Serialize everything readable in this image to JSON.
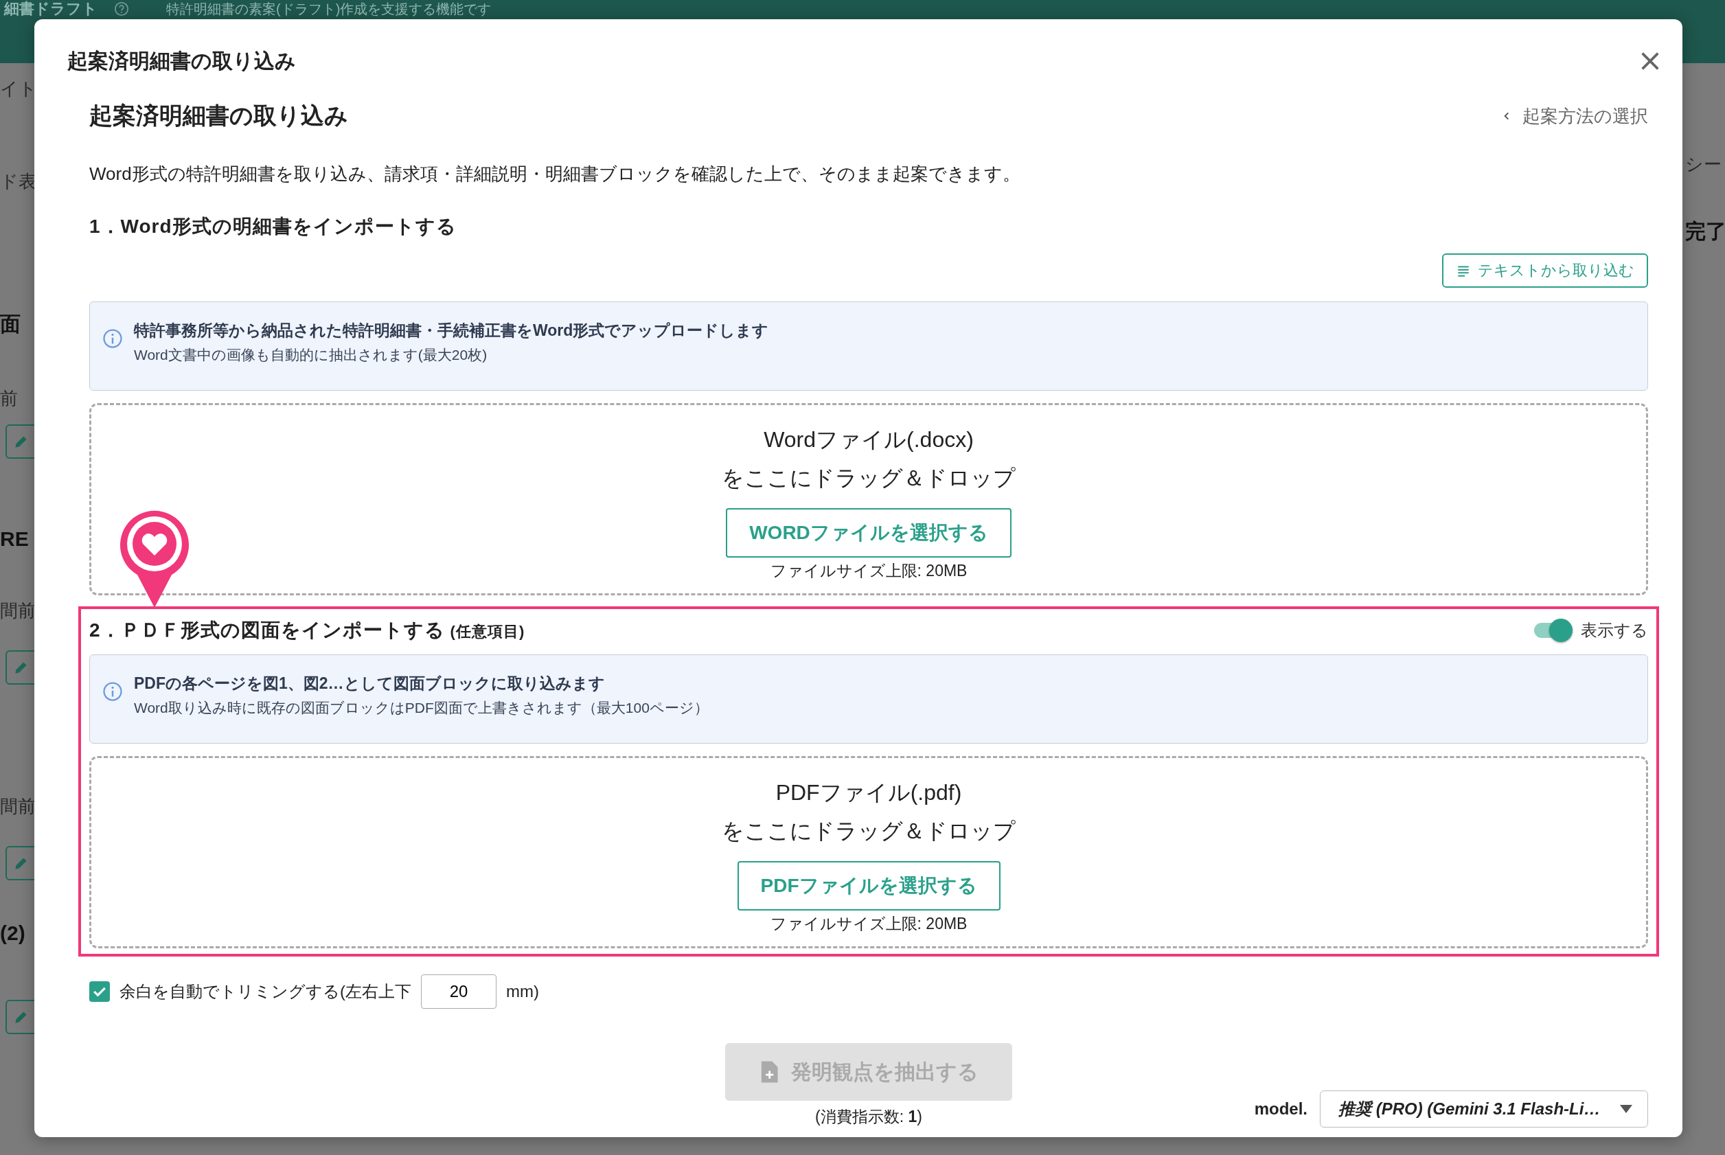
{
  "background": {
    "header_title": "細書ドラフト",
    "header_description": "特許明細書の素案(ドラフト)作成を支援する機能です",
    "left_items": [
      {
        "kind": "text",
        "text": "イト"
      },
      {
        "kind": "text",
        "text": "ド表"
      },
      {
        "kind": "bold",
        "text": "面"
      },
      {
        "kind": "text",
        "text": "前"
      },
      {
        "kind": "edit"
      },
      {
        "kind": "bold",
        "text": "RE"
      },
      {
        "kind": "text",
        "text": "間前"
      },
      {
        "kind": "edit"
      },
      {
        "kind": "text",
        "text": "間前"
      },
      {
        "kind": "edit"
      },
      {
        "kind": "bold",
        "text": "(2)"
      },
      {
        "kind": "edit"
      }
    ],
    "right_items": [
      {
        "kind": "text",
        "text": "シー"
      },
      {
        "kind": "bold",
        "text": "完了"
      }
    ]
  },
  "dialog": {
    "title": "起案済明細書の取り込み",
    "heading": "起案済明細書の取り込み",
    "back_link": "起案方法の選択",
    "description": "Word形式の特許明細書を取り込み、請求項・詳細説明・明細書ブロックを確認した上で、そのまま起案できます。",
    "sections": [
      {
        "heading": "1．Word形式の明細書をインポートする",
        "text_import_button": "テキストから取り込む",
        "highlighted": false,
        "info_title": "特許事務所等から納品された特許明細書・手続補正書をWord形式でアップロードします",
        "info_text": "Word文書中の画像も自動的に抽出されます(最大20枚)",
        "drop_title": "Wordファイル(.docx)",
        "drop_text": "をここにドラッグ＆ドロップ",
        "select_button": "WORDファイルを選択する",
        "size_limit": "ファイルサイズ上限: 20MB"
      },
      {
        "heading": "2．ＰＤＦ形式の図面をインポートする",
        "note": "(任意項目)",
        "toggle": {
          "label": "表示する",
          "on": true
        },
        "highlighted": true,
        "info_title": "PDFの各ページを図1、図2…として図面ブロックに取り込みます",
        "info_text": "Word取り込み時に既存の図面ブロックはPDF図面で上書きされます（最大100ページ）",
        "drop_title": "PDFファイル(.pdf)",
        "drop_text": "をここにドラッグ＆ドロップ",
        "select_button": "PDFファイルを選択する",
        "size_limit": "ファイルサイズ上限: 20MB"
      }
    ],
    "trim": {
      "label": "余白を自動でトリミングする(左右上下",
      "checked": true,
      "value": "20",
      "unit": "mm)"
    },
    "extract_button": {
      "label": "発明観点を抽出する",
      "disabled": true
    },
    "cost_note": "(消費指示数: **1**)",
    "model": {
      "label": "model.",
      "value": "推奨 (PRO) (Gemini 3.1 Flash-Li…"
    }
  }
}
